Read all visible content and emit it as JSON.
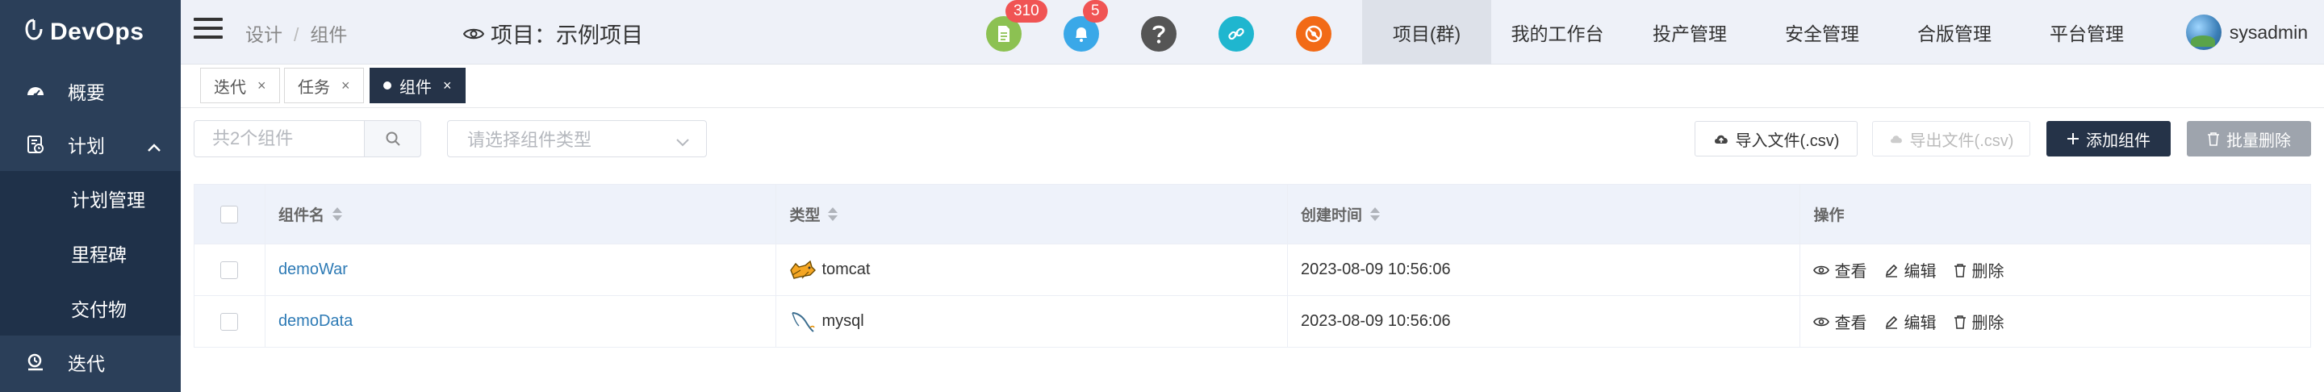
{
  "app": {
    "name": "DevOps"
  },
  "sidebar": {
    "items": [
      {
        "label": "概要",
        "icon": "dashboard-icon"
      },
      {
        "label": "计划",
        "icon": "plan-icon",
        "expanded": true,
        "children": [
          {
            "label": "计划管理"
          },
          {
            "label": "里程碑"
          },
          {
            "label": "交付物"
          }
        ]
      },
      {
        "label": "迭代",
        "icon": "iteration-icon"
      }
    ]
  },
  "header": {
    "breadcrumb": [
      "设计",
      "组件"
    ],
    "project_label": "项目：示例项目",
    "badges": {
      "docs": "310",
      "notifications": "5"
    },
    "nav": [
      "项目(群)",
      "我的工作台",
      "投产管理",
      "安全管理",
      "合版管理",
      "平台管理"
    ],
    "active_nav": "项目(群)",
    "user": "sysadmin"
  },
  "tabs": [
    {
      "label": "迭代",
      "active": false
    },
    {
      "label": "任务",
      "active": false
    },
    {
      "label": "组件",
      "active": true
    }
  ],
  "toolbar": {
    "search_placeholder": "共2个组件",
    "type_select_placeholder": "请选择组件类型",
    "import_label": "导入文件(.csv)",
    "export_label": "导出文件(.csv)",
    "add_label": "添加组件",
    "batch_delete_label": "批量删除"
  },
  "table": {
    "columns": [
      "组件名",
      "类型",
      "创建时间",
      "操作"
    ],
    "rows": [
      {
        "name": "demoWar",
        "type": "tomcat",
        "type_icon": "tomcat-icon",
        "created": "2023-08-09 10:56:06"
      },
      {
        "name": "demoData",
        "type": "mysql",
        "type_icon": "mysql-icon",
        "created": "2023-08-09 10:56:06"
      }
    ],
    "actions": {
      "view": "查看",
      "edit": "编辑",
      "delete": "删除"
    }
  },
  "colors": {
    "sidebar_bg": "#2b3f59",
    "accent_dark": "#253348",
    "link": "#2d7ab5",
    "badge": "#f05454"
  }
}
